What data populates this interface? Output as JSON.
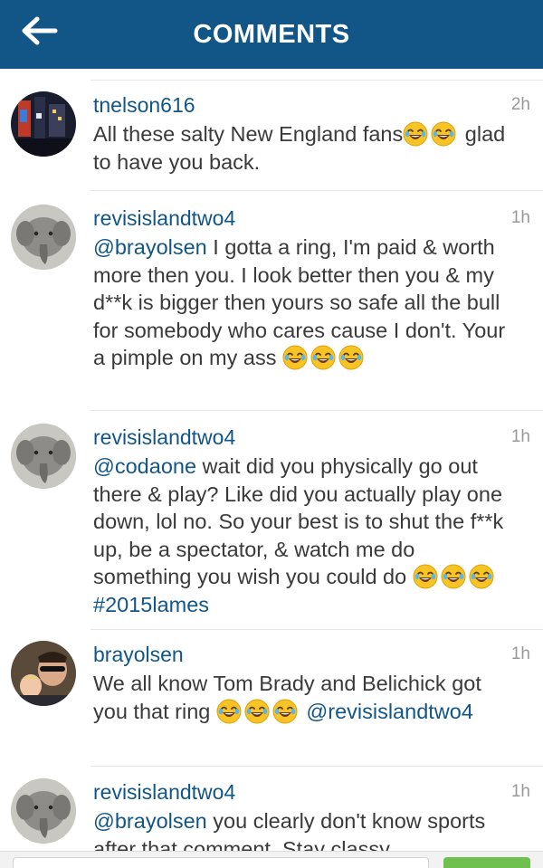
{
  "header": {
    "title": "COMMENTS",
    "back_icon": "arrow-left-icon",
    "background": "#125688"
  },
  "colors": {
    "link": "#125688",
    "text": "#3a3a3a",
    "timestamp": "#999999"
  },
  "comments": [
    {
      "username": "tnelson616",
      "time": "2h",
      "avatar": "city-night-avatar",
      "parts": [
        {
          "type": "text",
          "value": "All these salty New England fans"
        },
        {
          "type": "emoji",
          "value": "joy-emoji"
        },
        {
          "type": "emoji",
          "value": "joy-emoji"
        },
        {
          "type": "text",
          "value": " glad to have you back."
        }
      ]
    },
    {
      "username": "revisislandtwo4",
      "time": "1h",
      "avatar": "elephant-avatar",
      "parts": [
        {
          "type": "mention",
          "value": "@brayolsen"
        },
        {
          "type": "text",
          "value": " I gotta a ring, I'm paid & worth more then you. I look better then you & my d**k is bigger then yours so safe all the bull for somebody who cares cause I don't. Your a pimple on my ass "
        },
        {
          "type": "emoji",
          "value": "joy-emoji"
        },
        {
          "type": "emoji",
          "value": "joy-emoji"
        },
        {
          "type": "emoji",
          "value": "joy-emoji"
        }
      ]
    },
    {
      "username": "revisislandtwo4",
      "time": "1h",
      "avatar": "elephant-avatar",
      "parts": [
        {
          "type": "mention",
          "value": "@codaone"
        },
        {
          "type": "text",
          "value": " wait did you physically go out there & play? Like did you actually play one down, lol no. So your best is to shut the f**k  up, be a spectator, & watch me do something you wish you could do "
        },
        {
          "type": "emoji",
          "value": "joy-emoji"
        },
        {
          "type": "emoji",
          "value": "joy-emoji"
        },
        {
          "type": "emoji",
          "value": "joy-emoji"
        },
        {
          "type": "text",
          "value": " "
        },
        {
          "type": "hashtag",
          "value": "#2015lames"
        }
      ]
    },
    {
      "username": "brayolsen",
      "time": "1h",
      "avatar": "selfie-avatar",
      "parts": [
        {
          "type": "text",
          "value": "We all know Tom Brady and Belichick got you that ring "
        },
        {
          "type": "emoji",
          "value": "joy-emoji"
        },
        {
          "type": "emoji",
          "value": "joy-emoji"
        },
        {
          "type": "emoji",
          "value": "joy-emoji"
        },
        {
          "type": "text",
          "value": " "
        },
        {
          "type": "mention",
          "value": "@revisislandtwo4"
        }
      ]
    },
    {
      "username": "revisislandtwo4",
      "time": "1h",
      "avatar": "elephant-avatar",
      "parts": [
        {
          "type": "mention",
          "value": "@brayolsen"
        },
        {
          "type": "text",
          "value": " you clearly don't know sports after that comment. Stay classy"
        }
      ]
    }
  ],
  "bottom_bar": {
    "send_button_color": "#70c050"
  }
}
